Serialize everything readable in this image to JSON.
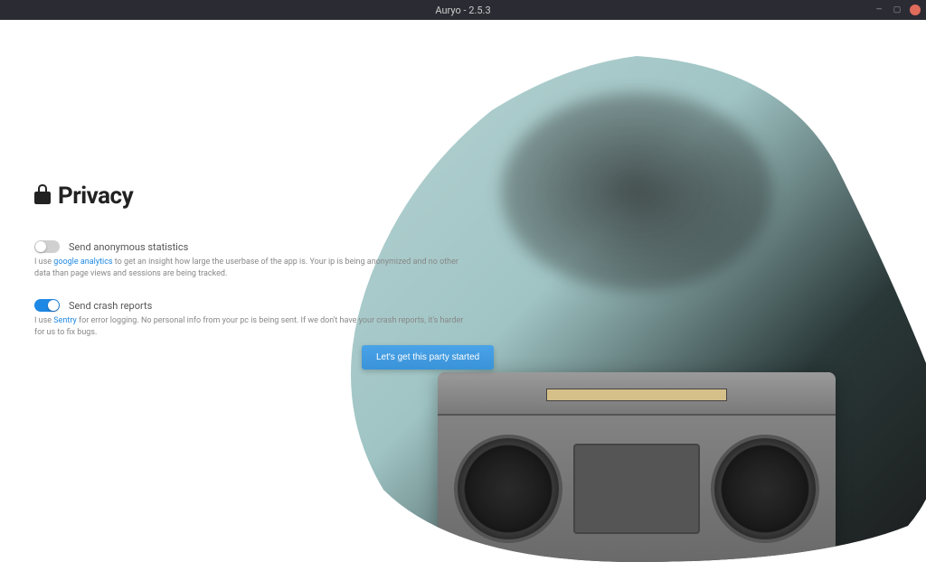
{
  "window": {
    "title": "Auryo - 2.5.3"
  },
  "page": {
    "heading": "Privacy",
    "icon_name": "lock-icon"
  },
  "settings": {
    "anonymous_stats": {
      "label": "Send anonymous statistics",
      "enabled": false,
      "desc_prefix": "I use ",
      "desc_link": "google analytics",
      "desc_suffix": " to get an insight how large the userbase of the app is. Your ip is being anonymized and no other data than page views and sessions are being tracked."
    },
    "crash_reports": {
      "label": "Send crash reports",
      "enabled": true,
      "desc_prefix": "I use ",
      "desc_link": "Sentry",
      "desc_suffix": " for error logging. No personal info from your pc is being sent. If we don't have your crash reports, it's harder for us to fix bugs."
    }
  },
  "cta": {
    "label": "Let's get this party started"
  }
}
